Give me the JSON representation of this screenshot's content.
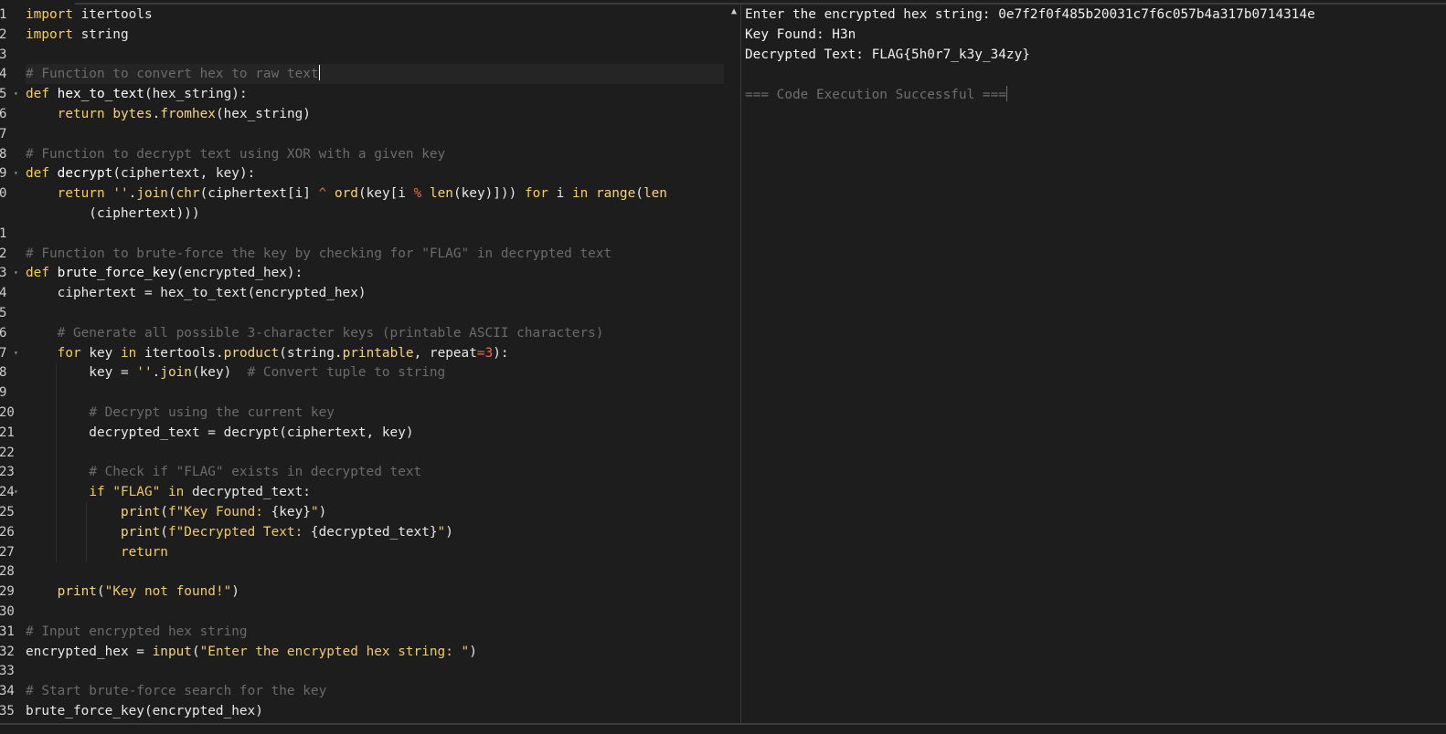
{
  "editor": {
    "lines": [
      {
        "n": "1",
        "fold": false,
        "indent": 0,
        "tokens": [
          [
            "kw",
            "import"
          ],
          [
            "pl",
            " itertools"
          ]
        ]
      },
      {
        "n": "2",
        "fold": false,
        "indent": 0,
        "tokens": [
          [
            "kw",
            "import"
          ],
          [
            "pl",
            " string"
          ]
        ]
      },
      {
        "n": "3",
        "fold": false,
        "indent": 0,
        "tokens": []
      },
      {
        "n": "4",
        "fold": false,
        "indent": 0,
        "active": true,
        "tokens": [
          [
            "cm",
            "# Function to convert hex to raw text"
          ]
        ]
      },
      {
        "n": "5",
        "fold": true,
        "indent": 0,
        "tokens": [
          [
            "kw",
            "def"
          ],
          [
            "pl",
            " "
          ],
          [
            "fn",
            "hex_to_text"
          ],
          [
            "pl",
            "(hex_string):"
          ]
        ]
      },
      {
        "n": "6",
        "fold": false,
        "indent": 1,
        "tokens": [
          [
            "pl",
            "    "
          ],
          [
            "kw",
            "return"
          ],
          [
            "pl",
            " "
          ],
          [
            "bi",
            "bytes"
          ],
          [
            "pl",
            "."
          ],
          [
            "bi",
            "fromhex"
          ],
          [
            "pl",
            "(hex_string)"
          ]
        ]
      },
      {
        "n": "7",
        "fold": false,
        "indent": 0,
        "tokens": []
      },
      {
        "n": "8",
        "fold": false,
        "indent": 0,
        "tokens": [
          [
            "cm",
            "# Function to decrypt text using XOR with a given key"
          ]
        ]
      },
      {
        "n": "9",
        "fold": true,
        "indent": 0,
        "tokens": [
          [
            "kw",
            "def"
          ],
          [
            "pl",
            " "
          ],
          [
            "fn",
            "decrypt"
          ],
          [
            "pl",
            "(ciphertext, key):"
          ]
        ]
      },
      {
        "n": "0",
        "fold": false,
        "indent": 1,
        "tokens": [
          [
            "pl",
            "    "
          ],
          [
            "kw",
            "return"
          ],
          [
            "pl",
            " "
          ],
          [
            "str",
            "''"
          ],
          [
            "pl",
            "."
          ],
          [
            "bi",
            "join"
          ],
          [
            "pl",
            "("
          ],
          [
            "bi",
            "chr"
          ],
          [
            "pl",
            "(ciphertext[i] "
          ],
          [
            "op",
            "^"
          ],
          [
            "pl",
            " "
          ],
          [
            "bi",
            "ord"
          ],
          [
            "pl",
            "(key[i "
          ],
          [
            "op",
            "%"
          ],
          [
            "pl",
            " "
          ],
          [
            "bi",
            "len"
          ],
          [
            "pl",
            "(key)])) "
          ],
          [
            "kw",
            "for"
          ],
          [
            "pl",
            " i "
          ],
          [
            "kw",
            "in"
          ],
          [
            "pl",
            " "
          ],
          [
            "bi",
            "range"
          ],
          [
            "pl",
            "("
          ],
          [
            "bi",
            "len"
          ]
        ]
      },
      {
        "n": "",
        "fold": false,
        "indent": 1,
        "tokens": [
          [
            "pl",
            "        (ciphertext)))"
          ]
        ]
      },
      {
        "n": "1",
        "fold": false,
        "indent": 0,
        "tokens": []
      },
      {
        "n": "2",
        "fold": false,
        "indent": 0,
        "tokens": [
          [
            "cm",
            "# Function to brute-force the key by checking for \"FLAG\" in decrypted text"
          ]
        ]
      },
      {
        "n": "3",
        "fold": true,
        "indent": 0,
        "tokens": [
          [
            "kw",
            "def"
          ],
          [
            "pl",
            " "
          ],
          [
            "fn",
            "brute_force_key"
          ],
          [
            "pl",
            "(encrypted_hex):"
          ]
        ]
      },
      {
        "n": "4",
        "fold": false,
        "indent": 1,
        "tokens": [
          [
            "pl",
            "    ciphertext = hex_to_text(encrypted_hex)"
          ]
        ]
      },
      {
        "n": "5",
        "fold": false,
        "indent": 1,
        "tokens": []
      },
      {
        "n": "6",
        "fold": false,
        "indent": 1,
        "tokens": [
          [
            "pl",
            "    "
          ],
          [
            "cm",
            "# Generate all possible 3-character keys (printable ASCII characters)"
          ]
        ]
      },
      {
        "n": "7",
        "fold": true,
        "indent": 1,
        "tokens": [
          [
            "pl",
            "    "
          ],
          [
            "kw",
            "for"
          ],
          [
            "pl",
            " key "
          ],
          [
            "kw",
            "in"
          ],
          [
            "pl",
            " itertools."
          ],
          [
            "bi",
            "product"
          ],
          [
            "pl",
            "(string."
          ],
          [
            "bi",
            "printable"
          ],
          [
            "pl",
            ", repeat"
          ],
          [
            "op",
            "="
          ],
          [
            "num",
            "3"
          ],
          [
            "pl",
            "):"
          ]
        ]
      },
      {
        "n": "8",
        "fold": false,
        "indent": 2,
        "tokens": [
          [
            "pl",
            "        key = "
          ],
          [
            "str",
            "''"
          ],
          [
            "pl",
            "."
          ],
          [
            "bi",
            "join"
          ],
          [
            "pl",
            "(key)  "
          ],
          [
            "cm",
            "# Convert tuple to string"
          ]
        ]
      },
      {
        "n": "9",
        "fold": false,
        "indent": 2,
        "tokens": []
      },
      {
        "n": "20",
        "fold": false,
        "indent": 2,
        "tokens": [
          [
            "pl",
            "        "
          ],
          [
            "cm",
            "# Decrypt using the current key"
          ]
        ]
      },
      {
        "n": "21",
        "fold": false,
        "indent": 2,
        "tokens": [
          [
            "pl",
            "        decrypted_text = decrypt(ciphertext, key)"
          ]
        ]
      },
      {
        "n": "22",
        "fold": false,
        "indent": 2,
        "tokens": []
      },
      {
        "n": "23",
        "fold": false,
        "indent": 2,
        "tokens": [
          [
            "pl",
            "        "
          ],
          [
            "cm",
            "# Check if \"FLAG\" exists in decrypted text"
          ]
        ]
      },
      {
        "n": "24",
        "fold": true,
        "indent": 2,
        "tokens": [
          [
            "pl",
            "        "
          ],
          [
            "kw",
            "if"
          ],
          [
            "pl",
            " "
          ],
          [
            "str",
            "\"FLAG\""
          ],
          [
            "pl",
            " "
          ],
          [
            "kw",
            "in"
          ],
          [
            "pl",
            " decrypted_text:"
          ]
        ]
      },
      {
        "n": "25",
        "fold": false,
        "indent": 3,
        "tokens": [
          [
            "pl",
            "            "
          ],
          [
            "bi",
            "print"
          ],
          [
            "pl",
            "("
          ],
          [
            "str",
            "f\"Key Found: "
          ],
          [
            "pl",
            "{key}"
          ],
          [
            "str",
            "\""
          ],
          [
            "pl",
            ")"
          ]
        ]
      },
      {
        "n": "26",
        "fold": false,
        "indent": 3,
        "tokens": [
          [
            "pl",
            "            "
          ],
          [
            "bi",
            "print"
          ],
          [
            "pl",
            "("
          ],
          [
            "str",
            "f\"Decrypted Text: "
          ],
          [
            "pl",
            "{decrypted_text}"
          ],
          [
            "str",
            "\""
          ],
          [
            "pl",
            ")"
          ]
        ]
      },
      {
        "n": "27",
        "fold": false,
        "indent": 3,
        "tokens": [
          [
            "pl",
            "            "
          ],
          [
            "kw",
            "return"
          ]
        ]
      },
      {
        "n": "28",
        "fold": false,
        "indent": 1,
        "tokens": []
      },
      {
        "n": "29",
        "fold": false,
        "indent": 1,
        "tokens": [
          [
            "pl",
            "    "
          ],
          [
            "bi",
            "print"
          ],
          [
            "pl",
            "("
          ],
          [
            "str",
            "\"Key not found!\""
          ],
          [
            "pl",
            ")"
          ]
        ]
      },
      {
        "n": "30",
        "fold": false,
        "indent": 0,
        "tokens": []
      },
      {
        "n": "31",
        "fold": false,
        "indent": 0,
        "tokens": [
          [
            "cm",
            "# Input encrypted hex string"
          ]
        ]
      },
      {
        "n": "32",
        "fold": false,
        "indent": 0,
        "tokens": [
          [
            "pl",
            "encrypted_hex = "
          ],
          [
            "bi",
            "input"
          ],
          [
            "pl",
            "("
          ],
          [
            "str",
            "\"Enter the encrypted hex string: \""
          ],
          [
            "pl",
            ")"
          ]
        ]
      },
      {
        "n": "33",
        "fold": false,
        "indent": 0,
        "tokens": []
      },
      {
        "n": "34",
        "fold": false,
        "indent": 0,
        "tokens": [
          [
            "cm",
            "# Start brute-force search for the key"
          ]
        ]
      },
      {
        "n": "35",
        "fold": false,
        "indent": 0,
        "tokens": [
          [
            "pl",
            "brute_force_key(encrypted_hex)"
          ]
        ]
      }
    ]
  },
  "output": {
    "lines": [
      {
        "text": "Enter the encrypted hex string: 0e7f2f0f485b20031c7f6c057b4a317b0714314e",
        "dim": false
      },
      {
        "text": "Key Found: H3n",
        "dim": false
      },
      {
        "text": "Decrypted Text: FLAG{5h0r7_k3y_34zy}",
        "dim": false
      },
      {
        "text": "",
        "dim": false
      },
      {
        "text": "=== Code Execution Successful ===",
        "dim": true
      }
    ]
  },
  "colors": {
    "background": "#1d1d1d",
    "keyword": "#f5cf5a",
    "comment": "#6b6b6b",
    "number": "#e66b4e"
  }
}
